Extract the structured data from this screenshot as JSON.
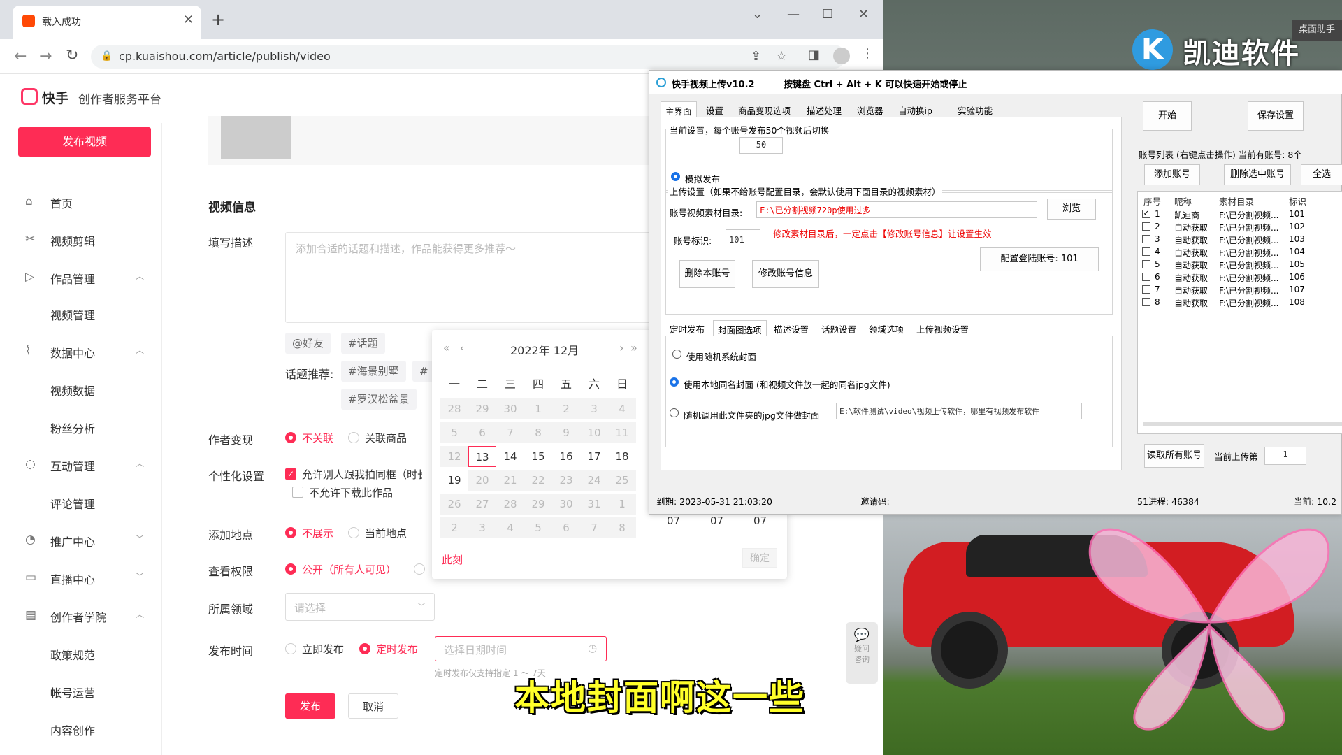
{
  "browser": {
    "tab_title": "载入成功",
    "url": "cp.kuaishou.com/article/publish/video"
  },
  "kuaishou": {
    "logo": "快手",
    "platform": "创作者服务平台",
    "publish_button": "发布视频",
    "sidebar": [
      {
        "label": "首页",
        "icon": "home-icon",
        "type": "item"
      },
      {
        "label": "视频剪辑",
        "icon": "scissors-icon",
        "type": "item"
      },
      {
        "label": "作品管理",
        "icon": "video-icon",
        "type": "group"
      },
      {
        "label": "视频管理",
        "type": "sub"
      },
      {
        "label": "数据中心",
        "icon": "chart-icon",
        "type": "group"
      },
      {
        "label": "视频数据",
        "type": "sub"
      },
      {
        "label": "粉丝分析",
        "type": "sub"
      },
      {
        "label": "互动管理",
        "icon": "chat-icon",
        "type": "group"
      },
      {
        "label": "评论管理",
        "type": "sub"
      },
      {
        "label": "推广中心",
        "icon": "rocket-icon",
        "type": "group"
      },
      {
        "label": "直播中心",
        "icon": "live-icon",
        "type": "group"
      },
      {
        "label": "创作者学院",
        "icon": "book-icon",
        "type": "group"
      },
      {
        "label": "政策规范",
        "type": "sub"
      },
      {
        "label": "帐号运营",
        "type": "sub"
      },
      {
        "label": "内容创作",
        "type": "sub"
      }
    ],
    "form": {
      "section_title": "视频信息",
      "desc_label": "填写描述",
      "desc_placeholder": "添加合适的话题和描述，作品能获得更多推荐～",
      "at_friend": "@好友",
      "topic": "#话题",
      "topic_rec_label": "话题推荐:",
      "topic_rec_1": "#海景别墅",
      "topic_rec_2": "#",
      "topic_rec_3": "#罗汉松盆景",
      "monetize_label": "作者变现",
      "monetize_opt1": "不关联",
      "monetize_opt2": "关联商品",
      "personal_label": "个性化设置",
      "personal_opt1": "允许别人跟我拍同框（时长",
      "personal_opt2": "不允许下载此作品",
      "location_label": "添加地点",
      "location_opt1": "不展示",
      "location_opt2": "当前地点",
      "view_label": "查看权限",
      "view_opt1": "公开（所有人可见）",
      "domain_label": "所属领域",
      "domain_placeholder": "请选择",
      "time_label": "发布时间",
      "time_opt1": "立即发布",
      "time_opt2": "定时发布",
      "date_placeholder": "选择日期时间",
      "time_note": "定时发布仅支持指定 1 ～ 7天",
      "submit": "发布",
      "cancel": "取消"
    },
    "calendar": {
      "title": "2022年  12月",
      "weekdays": [
        "一",
        "二",
        "三",
        "四",
        "五",
        "六",
        "日"
      ],
      "rows": [
        [
          "28",
          "29",
          "30",
          "1",
          "2",
          "3",
          "4"
        ],
        [
          "5",
          "6",
          "7",
          "8",
          "9",
          "10",
          "11"
        ],
        [
          "12",
          "13",
          "14",
          "15",
          "16",
          "17",
          "18"
        ],
        [
          "19",
          "20",
          "21",
          "22",
          "23",
          "24",
          "25"
        ],
        [
          "26",
          "27",
          "28",
          "29",
          "30",
          "31",
          "1"
        ],
        [
          "2",
          "3",
          "4",
          "5",
          "6",
          "7",
          "8"
        ]
      ],
      "now": "此刻",
      "ok": "确定",
      "time_h": "07",
      "time_m": "07",
      "time_s": "07"
    },
    "help": "疑问\n咨询"
  },
  "app": {
    "title": "快手视频上传v10.2",
    "hint": "按键盘 Ctrl + Alt + K 可以快速开始或停止",
    "tabs": [
      "主界面",
      "设置",
      "商品变现选项",
      "描述处理",
      "浏览器",
      "自动换ip",
      "实验功能"
    ],
    "start": "开始",
    "save": "保存设置",
    "current_setting": "当前设置，每个账号发布50个视频后切换",
    "switch_count": "50",
    "simulate": "模拟发布",
    "upload_setting": "上传设置（如果不给账号配置目录，会默认使用下面目录的视频素材）",
    "material_dir_label": "账号视频素材目录:",
    "material_dir": "F:\\已分割视频720p使用过多",
    "browse": "浏览",
    "account_id_label": "账号标识:",
    "account_id": "101",
    "modify_note": "修改素材目录后，一定点击【修改账号信息】让设置生效",
    "config_login": "配置登陆账号: 101",
    "delete_account": "删除本账号",
    "modify_account": "修改账号信息",
    "sub_tabs": [
      "定时发布",
      "封面图选项",
      "描述设置",
      "话题设置",
      "领域选项",
      "上传视频设置"
    ],
    "cover_opt1": "使用随机系统封面",
    "cover_opt2": "使用本地同名封面 (和视频文件放一起的同名jpg文件)",
    "cover_opt3": "随机调用此文件夹的jpg文件做封面",
    "cover_dir": "E:\\软件测试\\video\\视频上传软件，哪里有视频发布软件",
    "expire": "到期: 2023-05-31 21:03:20",
    "invite": "邀请码:",
    "process": "51进程: 46384",
    "current": "当前: 10.2",
    "acc_list_title": "账号列表 (右键点击操作) 当前有账号: 8个",
    "add_account": "添加账号",
    "delete_selected": "删除选中账号",
    "select_all": "全选",
    "acc_headers": [
      "序号",
      "昵称",
      "素材目录",
      "标识"
    ],
    "accounts": [
      {
        "no": "1",
        "name": "凯迪商",
        "dir": "F:\\已分割视频...",
        "id": "101",
        "checked": true
      },
      {
        "no": "2",
        "name": "自动获取",
        "dir": "F:\\已分割视频...",
        "id": "102",
        "checked": false
      },
      {
        "no": "3",
        "name": "自动获取",
        "dir": "F:\\已分割视频...",
        "id": "103",
        "checked": false
      },
      {
        "no": "4",
        "name": "自动获取",
        "dir": "F:\\已分割视频...",
        "id": "104",
        "checked": false
      },
      {
        "no": "5",
        "name": "自动获取",
        "dir": "F:\\已分割视频...",
        "id": "105",
        "checked": false
      },
      {
        "no": "6",
        "name": "自动获取",
        "dir": "F:\\已分割视频...",
        "id": "106",
        "checked": false
      },
      {
        "no": "7",
        "name": "自动获取",
        "dir": "F:\\已分割视频...",
        "id": "107",
        "checked": false
      },
      {
        "no": "8",
        "name": "自动获取",
        "dir": "F:\\已分割视频...",
        "id": "108",
        "checked": false
      }
    ],
    "read_all": "读取所有账号",
    "current_upload_label": "当前上传第",
    "current_upload_value": "1"
  },
  "desktop": {
    "brand": "凯迪软件",
    "brand_logo_letter": "K",
    "helper": "桌面助手"
  },
  "subtitle": "本地封面啊这一些",
  "colors": {
    "accent": "#fe2c55",
    "app_blue": "#1a73e8",
    "subtitle": "#ffff2a"
  }
}
